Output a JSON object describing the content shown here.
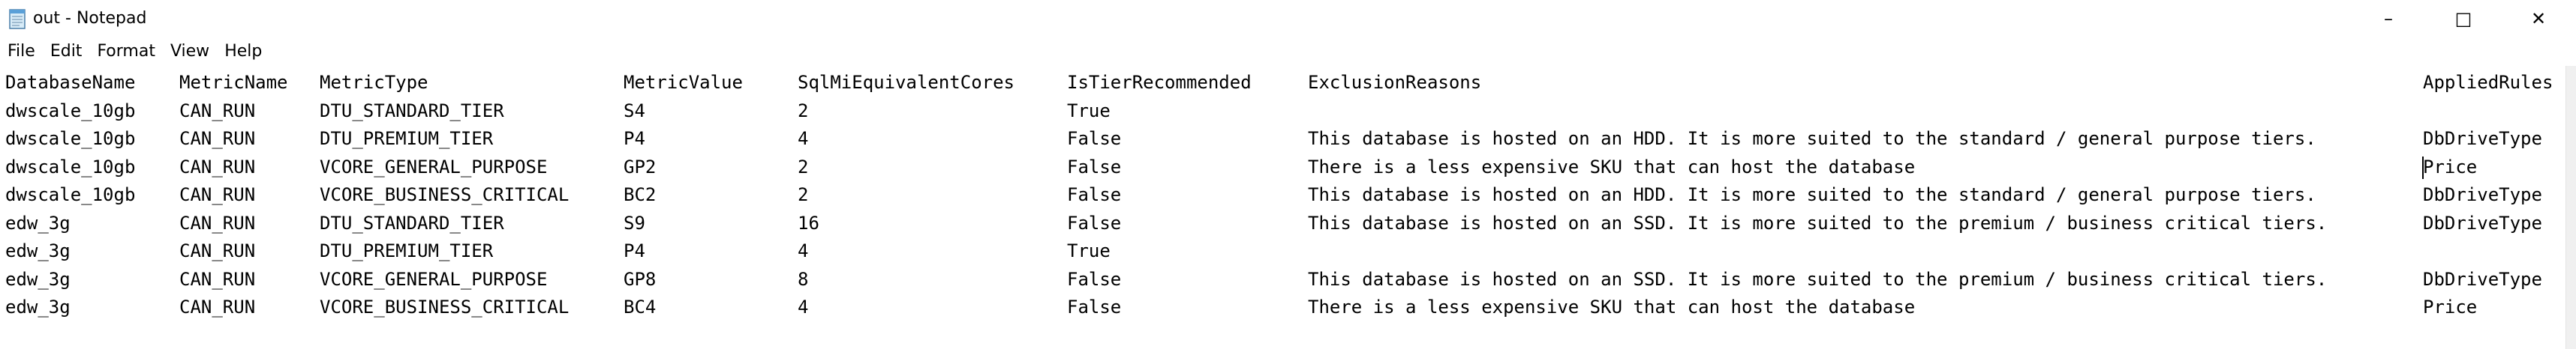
{
  "window": {
    "title": "out - Notepad",
    "minimize_glyph": "–",
    "maximize_glyph": "□",
    "close_glyph": "✕",
    "icon": "notepad-icon"
  },
  "menu": [
    "File",
    "Edit",
    "Format",
    "View",
    "Help"
  ],
  "table": {
    "headers": [
      "DatabaseName",
      "MetricName",
      "MetricType",
      "MetricValue",
      "SqlMiEquivalentCores",
      "IsTierRecommended",
      "ExclusionReasons",
      "AppliedRules"
    ],
    "rows": [
      [
        "dwscale_10gb",
        "CAN_RUN",
        "DTU_STANDARD_TIER",
        "S4",
        "2",
        "True",
        "",
        ""
      ],
      [
        "dwscale_10gb",
        "CAN_RUN",
        "DTU_PREMIUM_TIER",
        "P4",
        "4",
        "False",
        "This database is hosted on an HDD. It is more suited to the standard / general purpose tiers.",
        "DbDriveType"
      ],
      [
        "dwscale_10gb",
        "CAN_RUN",
        "VCORE_GENERAL_PURPOSE",
        "GP2",
        "2",
        "False",
        "There is a less expensive SKU that can host the database",
        "Price"
      ],
      [
        "dwscale_10gb",
        "CAN_RUN",
        "VCORE_BUSINESS_CRITICAL",
        "BC2",
        "2",
        "False",
        "This database is hosted on an HDD. It is more suited to the standard / general purpose tiers.",
        "DbDriveType"
      ],
      [
        "edw_3g",
        "CAN_RUN",
        "DTU_STANDARD_TIER",
        "S9",
        "16",
        "False",
        "This database is hosted on an SSD. It is more suited to the premium / business critical tiers.",
        "DbDriveType"
      ],
      [
        "edw_3g",
        "CAN_RUN",
        "DTU_PREMIUM_TIER",
        "P4",
        "4",
        "True",
        "",
        ""
      ],
      [
        "edw_3g",
        "CAN_RUN",
        "VCORE_GENERAL_PURPOSE",
        "GP8",
        "8",
        "False",
        "This database is hosted on an SSD. It is more suited to the premium / business critical tiers.",
        "DbDriveType"
      ],
      [
        "edw_3g",
        "CAN_RUN",
        "VCORE_BUSINESS_CRITICAL",
        "BC4",
        "4",
        "False",
        "There is a less expensive SKU that can host the database",
        "Price"
      ]
    ]
  }
}
